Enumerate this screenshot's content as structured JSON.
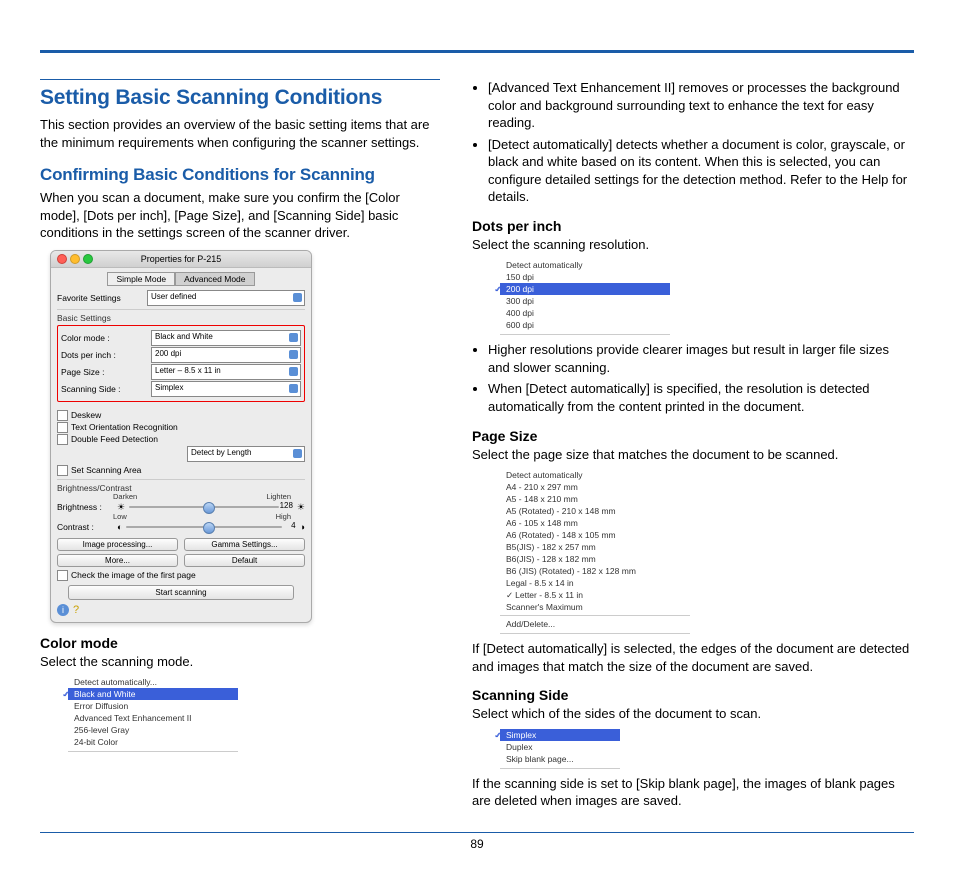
{
  "page_number": "89",
  "left": {
    "h1": "Setting Basic Scanning Conditions",
    "intro": "This section provides an overview of the basic setting items that are the minimum requirements when configuring the scanner settings.",
    "h2": "Confirming Basic Conditions for Scanning",
    "p1": "When you scan a document, make sure you confirm the [Color mode], [Dots per inch], [Page Size], and [Scanning Side] basic conditions in the settings screen of the scanner driver.",
    "dialog": {
      "title": "Properties for P-215",
      "tab_simple": "Simple Mode",
      "tab_advanced": "Advanced Mode",
      "fav_label": "Favorite Settings",
      "fav_value": "User defined",
      "basic_heading": "Basic Settings",
      "rows": [
        {
          "label": "Color mode :",
          "value": "Black and White"
        },
        {
          "label": "Dots per inch :",
          "value": "200 dpi"
        },
        {
          "label": "Page Size :",
          "value": "Letter – 8.5 x 11 in"
        },
        {
          "label": "Scanning Side :",
          "value": "Simplex"
        }
      ],
      "check_deskew": "Deskew",
      "check_tor": "Text Orientation Recognition",
      "check_dfd": "Double Feed Detection",
      "detect_length": "Detect by Length",
      "check_area": "Set Scanning Area",
      "bc_heading": "Brightness/Contrast",
      "darken": "Darken",
      "lighten": "Lighten",
      "brightness": "Brightness :",
      "brightness_val": "128",
      "low": "Low",
      "high": "High",
      "contrast": "Contrast :",
      "contrast_val": "4",
      "btn_imgproc": "Image processing...",
      "btn_gamma": "Gamma Settings...",
      "btn_more": "More...",
      "btn_default": "Default",
      "check_firstpage": "Check the image of the first page",
      "btn_start": "Start scanning"
    },
    "color_mode_h": "Color mode",
    "color_mode_p": "Select the scanning mode.",
    "color_mode_list": [
      "Detect automatically...",
      "Black and White",
      "Error Diffusion",
      "Advanced Text Enhancement II",
      "256-level Gray",
      "24-bit Color"
    ]
  },
  "right": {
    "bullets_top": [
      "[Advanced Text Enhancement II] removes or processes the background color and background surrounding text to enhance the text for easy reading.",
      "[Detect automatically] detects whether a document is color, grayscale, or black and white based on its content. When this is selected, you can configure detailed settings for the detection method. Refer to the Help for details."
    ],
    "dpi_h": "Dots per inch",
    "dpi_p": "Select the scanning resolution.",
    "dpi_list": [
      "Detect automatically",
      "150 dpi",
      "200 dpi",
      "300 dpi",
      "400 dpi",
      "600 dpi"
    ],
    "dpi_bullets": [
      "Higher resolutions provide clearer images but result in larger file sizes and slower scanning.",
      "When [Detect automatically] is specified, the resolution is detected automatically from the content printed in the document."
    ],
    "page_h": "Page Size",
    "page_p": "Select the page size that matches the document to be scanned.",
    "page_list": [
      "Detect automatically",
      "A4 - 210 x 297 mm",
      "A5 - 148 x 210 mm",
      "A5 (Rotated) - 210 x 148 mm",
      "A6 - 105 x 148 mm",
      "A6 (Rotated) - 148 x 105 mm",
      "B5(JIS) - 182 x 257 mm",
      "B6(JIS) - 128 x 182 mm",
      "B6 (JIS) (Rotated) - 182 x 128 mm",
      "Legal - 8.5 x 14 in",
      "Letter - 8.5 x 11 in",
      "Scanner's Maximum"
    ],
    "page_add": "Add/Delete...",
    "page_after": "If [Detect automatically] is selected, the edges of the document are detected and images that match the size of the document are saved.",
    "side_h": "Scanning Side",
    "side_p": "Select which of the sides of the document to scan.",
    "side_list": [
      "Simplex",
      "Duplex",
      "Skip blank page..."
    ],
    "side_after": "If the scanning side is set to [Skip blank page], the images of blank pages are deleted when images are saved."
  }
}
